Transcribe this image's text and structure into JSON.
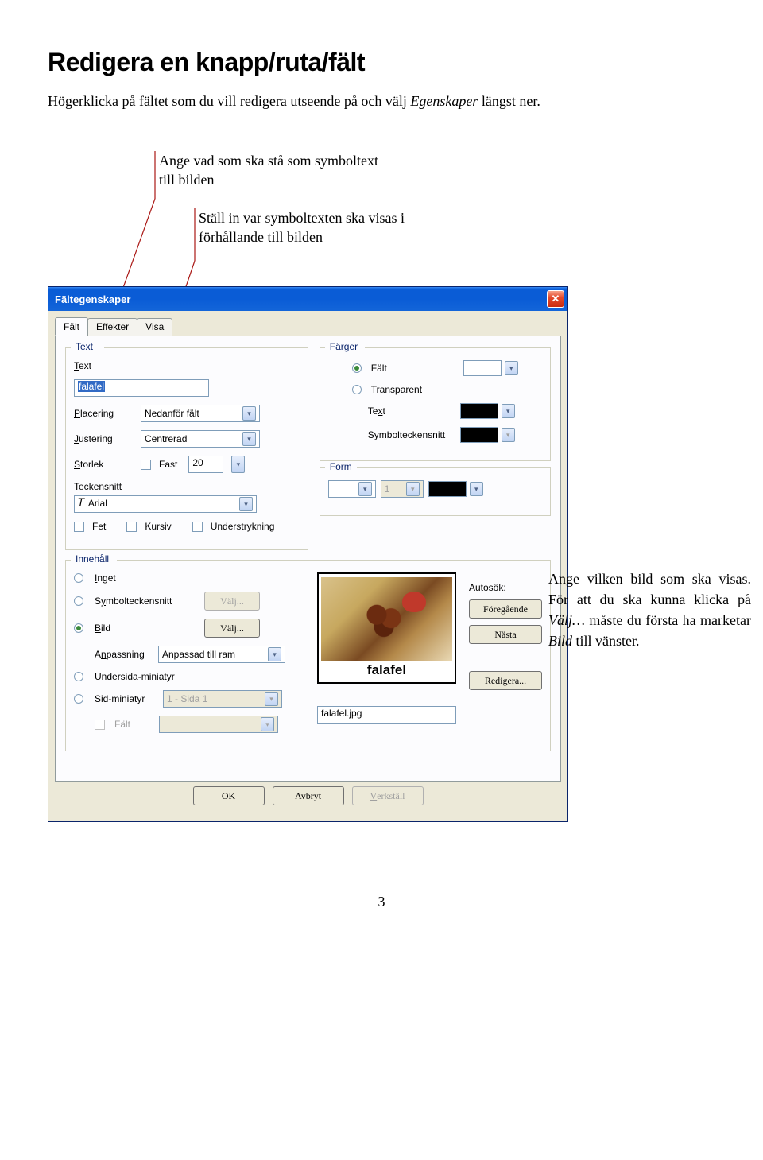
{
  "page": {
    "heading": "Redigera en knapp/ruta/fält",
    "intro_pre": "Högerklicka på fältet som du vill redigera utseende på och välj ",
    "intro_em": "Egenskaper",
    "intro_post": " längst ner.",
    "number": "3"
  },
  "annotations": {
    "a1": "Ange vad som ska stå som symboltext till bilden",
    "a2": "Ställ in var symboltexten ska visas i förhållande till bilden",
    "right_1": "Ange vilken bild som ska visas. För att du ska kunna klicka på ",
    "right_em1": "Välj…",
    "right_2": " måste du första ha marketar ",
    "right_em2": "Bild",
    "right_3": " till vänster."
  },
  "dialog": {
    "title": "Fältegenskaper",
    "tabs": {
      "t1": "Fält",
      "t2": "Effekter",
      "t3": "Visa"
    },
    "text_group": {
      "title": "Text",
      "text_value": "falafel",
      "placering_label": "Placering",
      "placering_value": "Nedanför fält",
      "justering_label": "Justering",
      "justering_value": "Centrerad",
      "storlek_label": "Storlek",
      "fast_label": "Fast",
      "size_value": "20",
      "teckensnitt_label": "Teckensnitt",
      "font_value": "Arial",
      "fet": "Fet",
      "kursiv": "Kursiv",
      "under": "Understrykning",
      "text_label": "Text"
    },
    "colors_group": {
      "title": "Färger",
      "falt": "Fält",
      "transparent": "Transparent",
      "text": "Text",
      "symbol": "Symbolteckensnitt"
    },
    "form_group": {
      "title": "Form",
      "thickness": "1"
    },
    "content_group": {
      "title": "Innehåll",
      "inget": "Inget",
      "symbol": "Symbolteckensnitt",
      "bild": "Bild",
      "valj": "Välj...",
      "anpassning_label": "Anpassning",
      "anpassning_value": "Anpassad till ram",
      "undersida": "Undersida-miniatyr",
      "sidminiatyr": "Sid-miniatyr",
      "sidvalue": "1 - Sida 1",
      "falt": "Fält",
      "autosok": "Autosök:",
      "foregaende": "Föregående",
      "nasta": "Nästa",
      "redigera": "Redigera...",
      "filename": "falafel.jpg",
      "caption": "falafel"
    },
    "buttons": {
      "ok": "OK",
      "avbryt": "Avbryt",
      "verkstall": "Verkställ"
    }
  }
}
